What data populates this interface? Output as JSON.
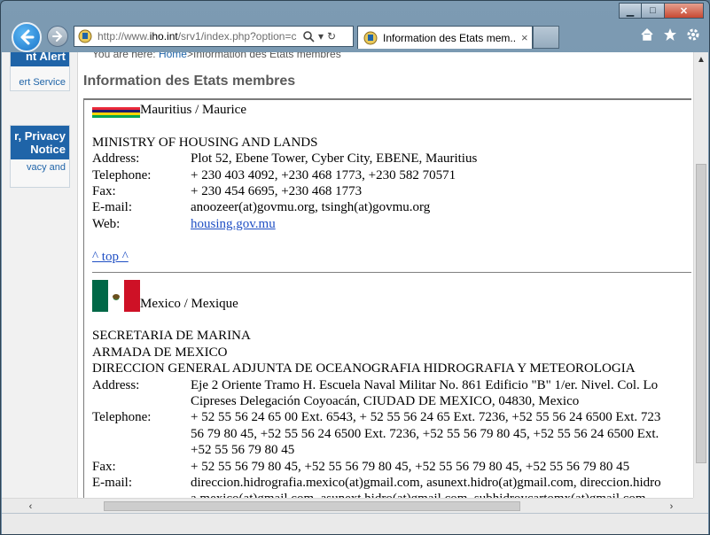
{
  "browser": {
    "url_prefix": "http://www.",
    "url_domain": "iho.int",
    "url_suffix": "/srv1/index.php?option=c",
    "tab_title": "Information des Etats mem...",
    "tab_close": "×"
  },
  "sidebar": {
    "box1": {
      "title": "nt Alert",
      "link": "ert Service"
    },
    "box2": {
      "title_line1": "r, Privacy",
      "title_line2": "Notice",
      "link": "vacy and"
    }
  },
  "page": {
    "breadcrumb_prefix": "You are here:",
    "breadcrumb_home": "Home",
    "breadcrumb_current": ">Information des Etats membres",
    "heading": "Information des Etats membres"
  },
  "labels": {
    "address": "Address:",
    "telephone": "Telephone:",
    "fax": "Fax:",
    "email": "E-mail:",
    "web": "Web:",
    "top": "^ top ^"
  },
  "mauritius": {
    "country": "Mauritius / Maurice",
    "flag_colors": [
      "#ea2839",
      "#1a206d",
      "#ffd500",
      "#00a551"
    ],
    "org": "MINISTRY OF HOUSING AND LANDS",
    "address": "Plot 52, Ebene Tower, Cyber City, EBENE, Mauritius",
    "telephone": "+ 230 403 4092, +230 468 1773, +230 582 70571",
    "fax": "+ 230 454 6695, +230 468 1773",
    "email": "anoozeer(at)govmu.org, tsingh(at)govmu.org",
    "web": "housing.gov.mu"
  },
  "mexico": {
    "country": "Mexico / Mexique",
    "flag_colors": [
      "#006847",
      "#ffffff",
      "#ce1126"
    ],
    "org_line1": "SECRETARIA DE MARINA",
    "org_line2": "ARMADA DE MEXICO",
    "org_line3": "DIRECCION GENERAL ADJUNTA DE OCEANOGRAFIA HIDROGRAFIA Y METEOROLOGIA",
    "address_line1": "Eje 2 Oriente Tramo H. Escuela Naval Militar No. 861 Edificio \"B\" 1/er. Nivel. Col. Lo",
    "address_line2": "Cipreses Delegación Coyoacán, CIUDAD DE MEXICO, 04830, Mexico",
    "telephone_line1": "+ 52 55 56 24 65 00 Ext. 6543, + 52 55 56 24 65 Ext. 7236, +52 55 56 24 6500 Ext. 723",
    "telephone_line2": "56 79 80 45, +52 55 56 24 6500 Ext. 7236, +52 55 56 79 80 45, +52 55 56 24 6500 Ext.",
    "telephone_line3": "+52 55 56 79 80 45",
    "fax": "+ 52 55 56 79 80 45, +52 55 56 79 80 45, +52 55 56 79 80 45, +52 55 56 79 80 45",
    "email_line1": "direccion.hidrografia.mexico(at)gmail.com, asunext.hidro(at)gmail.com, direccion.hidro",
    "email_line2": "a.mexico(at)gmail.com, asunext.hidro(at)gmail.com, subhidroycartomx(at)gmail.com"
  }
}
